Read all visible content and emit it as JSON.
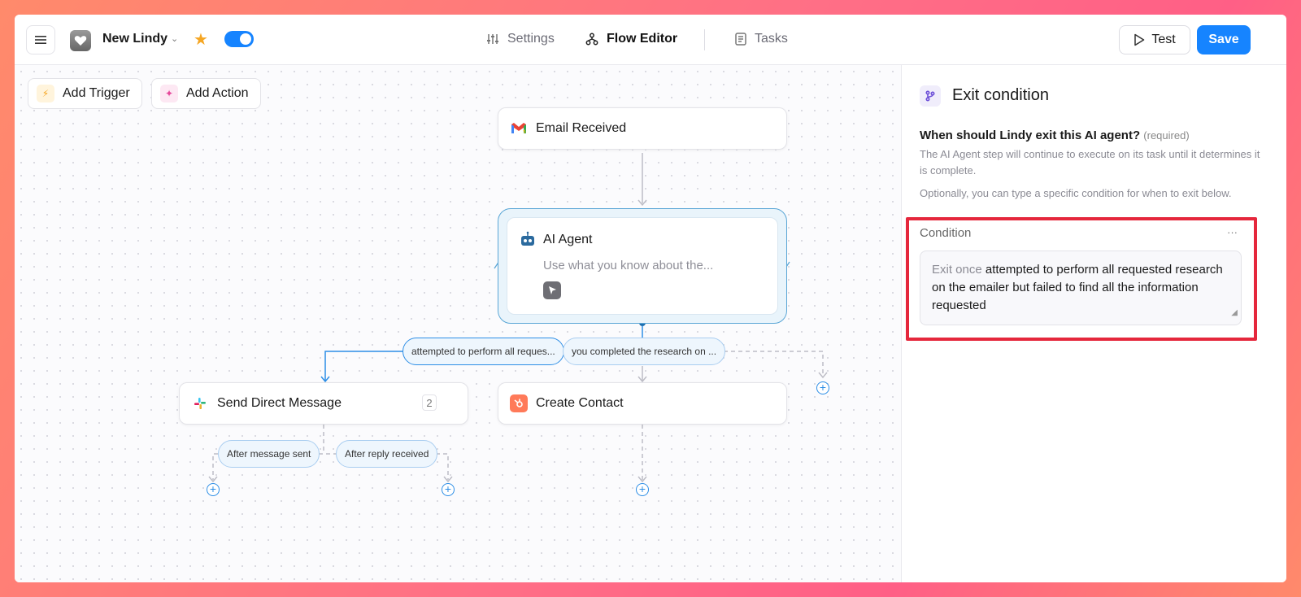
{
  "app": {
    "name": "New Lindy",
    "starred": true,
    "enabled": true
  },
  "nav": {
    "settings": "Settings",
    "flow_editor": "Flow Editor",
    "tasks": "Tasks",
    "active": "Flow Editor"
  },
  "toolbar": {
    "test_label": "Test",
    "save_label": "Save"
  },
  "canvas": {
    "add_trigger": "Add Trigger",
    "add_action": "Add Action",
    "nodes": {
      "email": "Email Received",
      "agent_title": "AI Agent",
      "agent_desc": "Use what you know about the...",
      "send_dm": "Send Direct Message",
      "send_dm_count": "2",
      "create_contact": "Create Contact"
    },
    "branches": {
      "left": "attempted to perform all reques...",
      "right": "you completed the research on ...",
      "after_sent": "After message sent",
      "after_reply": "After reply received"
    }
  },
  "panel": {
    "title": "Exit condition",
    "question": "When should Lindy exit this AI agent?",
    "required": "(required)",
    "help1": "The AI Agent step will continue to execute on its task until it determines it is complete.",
    "help2": "Optionally, you can type a specific condition for when to exit below.",
    "condition_label": "Condition",
    "condition_more": "···",
    "condition_prefix": "Exit once",
    "condition_text": " attempted to perform all requested research on the emailer but failed to find all the information requested"
  },
  "colors": {
    "accent": "#1684ff",
    "highlight": "#e5273c",
    "star": "#f5a623"
  },
  "icons": [
    "menu-icon",
    "app-logo-icon",
    "chevron-down-icon",
    "star-icon",
    "sliders-icon",
    "flow-icon",
    "tasks-icon",
    "play-icon",
    "bolt-icon",
    "cursor-sparkle-icon",
    "gmail-icon",
    "robot-icon",
    "pointer-icon",
    "slack-icon",
    "hubspot-icon",
    "branch-icon",
    "plus-icon"
  ]
}
